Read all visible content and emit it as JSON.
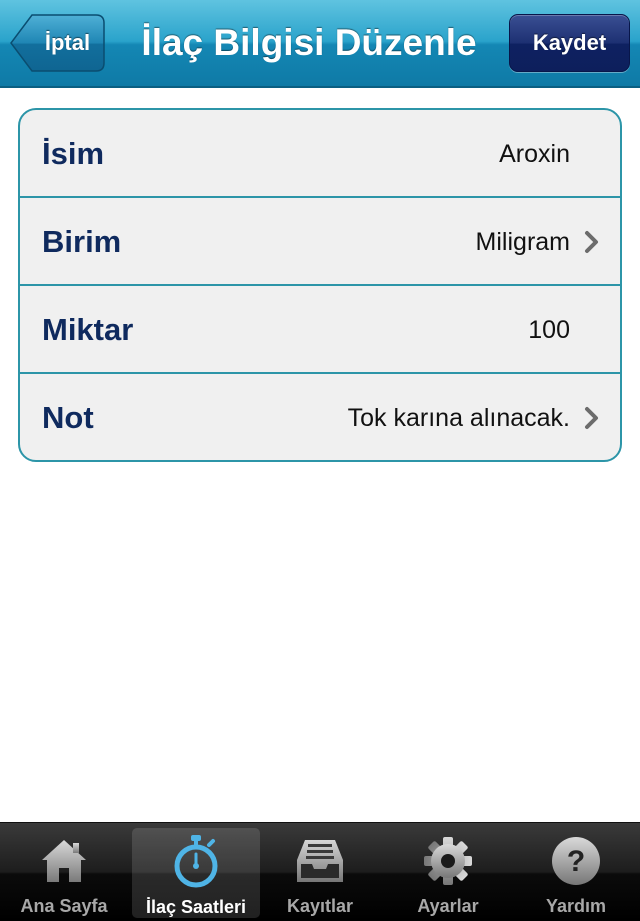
{
  "nav": {
    "title": "İlaç Bilgisi Düzenle",
    "cancel_label": "İptal",
    "save_label": "Kaydet"
  },
  "form": {
    "rows": [
      {
        "label": "İsim",
        "value": "Aroxin",
        "chevron": false
      },
      {
        "label": "Birim",
        "value": "Miligram",
        "chevron": true
      },
      {
        "label": "Miktar",
        "value": "100",
        "chevron": false
      },
      {
        "label": "Not",
        "value": "Tok karına alınacak.",
        "chevron": true
      }
    ]
  },
  "tabbar": {
    "tabs": [
      {
        "label": "Ana Sayfa",
        "icon": "home-icon",
        "active": false
      },
      {
        "label": "İlaç Saatleri",
        "icon": "stopwatch-icon",
        "active": true
      },
      {
        "label": "Kayıtlar",
        "icon": "archive-tray-icon",
        "active": false
      },
      {
        "label": "Ayarlar",
        "icon": "gear-icon",
        "active": false
      },
      {
        "label": "Yardım",
        "icon": "help-icon",
        "active": false
      }
    ]
  },
  "colors": {
    "nav_blue": "#1d95c2",
    "save_button": "#1d3072",
    "table_border": "#2c95a8",
    "label_text": "#0f2a5e",
    "active_tab_icon": "#4fb4e6"
  }
}
